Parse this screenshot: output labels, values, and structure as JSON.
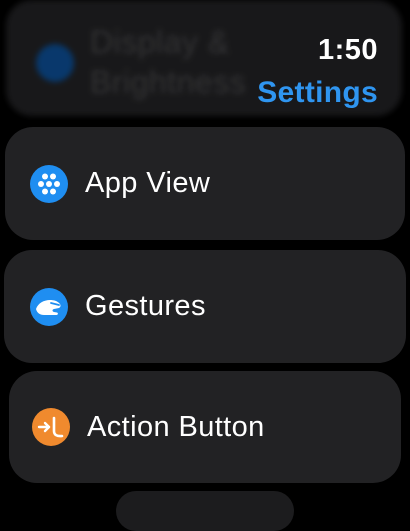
{
  "header": {
    "time": "1:50",
    "title": "Settings"
  },
  "ghost_row": {
    "label_line1": "Display &",
    "label_line2": "Brightness",
    "icon": "display-brightness-icon"
  },
  "rows": [
    {
      "label": "App View",
      "icon": "app-grid-icon",
      "color": "#1f8ef1"
    },
    {
      "label": "Gestures",
      "icon": "hand-gesture-icon",
      "color": "#1f8ef1"
    },
    {
      "label": "Action Button",
      "icon": "action-button-icon",
      "color": "#f08a2e"
    }
  ]
}
